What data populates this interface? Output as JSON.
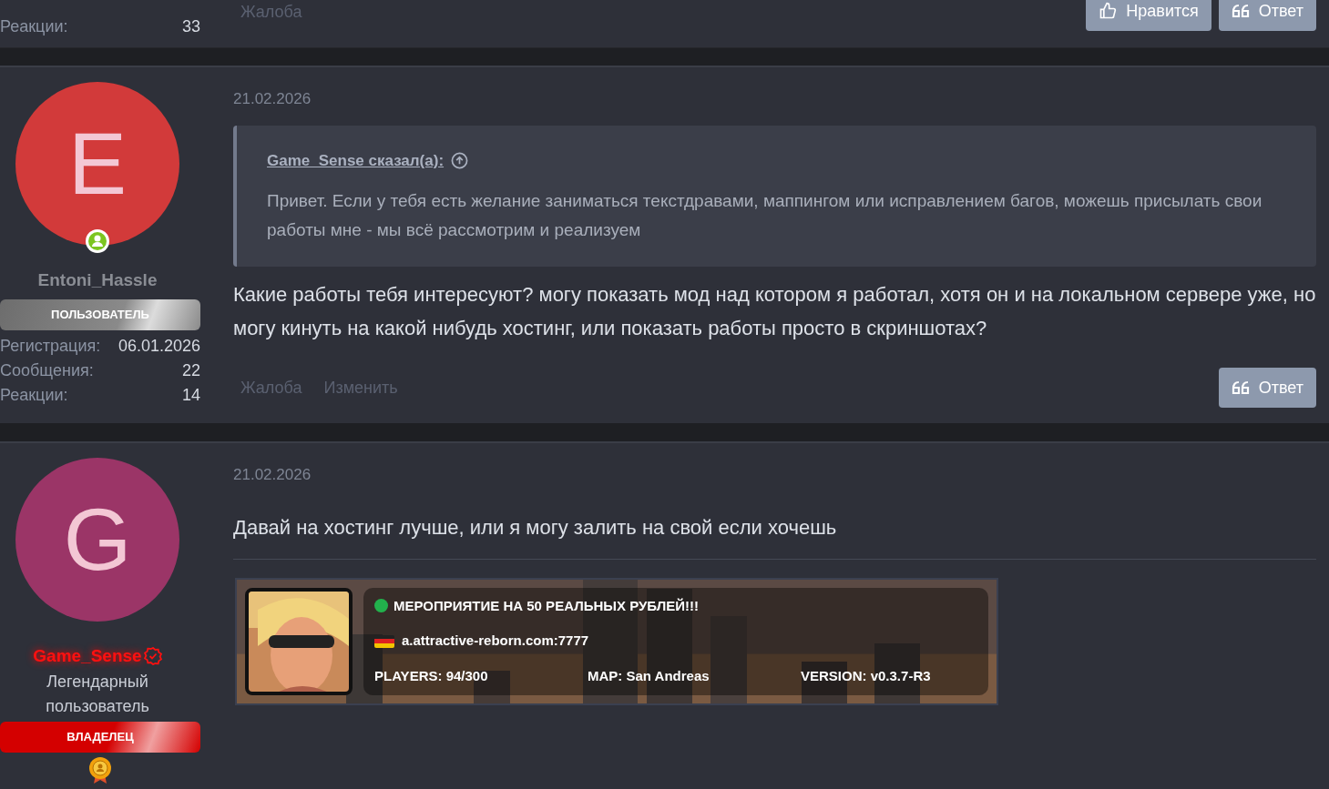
{
  "posts": [
    {
      "kind": "partial",
      "stats": [
        {
          "label": "Реакции:",
          "value": "33"
        }
      ],
      "actions": [
        "Жалоба"
      ],
      "buttons": [
        {
          "kind": "like",
          "label": "Нравится"
        },
        {
          "kind": "reply",
          "label": "Ответ"
        }
      ]
    },
    {
      "kind": "full",
      "avatar_letter": "E",
      "color": "#d23a3a",
      "online": true,
      "username": {
        "kind": "member",
        "text": "Entoni_Hassle"
      },
      "verified": false,
      "badge": {
        "kind": "user",
        "label": "ПОЛЬЗОВАТЕЛЬ"
      },
      "stats": [
        {
          "label": "Регистрация:",
          "value": "06.01.2026"
        },
        {
          "label": "Сообщения:",
          "value": "22"
        },
        {
          "label": "Реакции:",
          "value": "14"
        }
      ],
      "date": "21.02.2026",
      "quote": {
        "author": "Game_Sense сказал(а):",
        "text": "Привет. Если у тебя есть желание заниматься текстдравами, маппингом или исправлением багов, можешь присылать свои работы мне - мы всё рассмотрим и реализуем"
      },
      "body": "Какие работы тебя интересуют? могу показать мод над котором я работал, хотя он и на локальном сервере уже, но могу кинуть на какой нибудь хостинг, или показать работы просто в скриншотах?",
      "actions": [
        "Жалоба",
        "Изменить"
      ],
      "buttons": [
        {
          "kind": "reply",
          "label": "Ответ"
        }
      ]
    },
    {
      "kind": "full",
      "avatar_letter": "G",
      "color": "#9b3567",
      "online": false,
      "username": {
        "kind": "owner",
        "text": "Game_Sense"
      },
      "verified": true,
      "user_title": "Легендарный пользователь",
      "badge": {
        "kind": "owner",
        "label": "ВЛАДЕЛЕЦ"
      },
      "medal": true,
      "date": "21.02.2026",
      "body": "Давай на хостинг лучше, или я могу залить на свой если хочешь",
      "server_banner": {
        "name": "МЕРОПРИЯТИЕ НА 50 РЕАЛЬНЫХ РУБЛЕЙ!!!",
        "online": true,
        "address": "a.attractive-reborn.com:7777",
        "players": "PLAYERS: 94/300",
        "map": "MAP: San Andreas",
        "version": "VERSION: v0.3.7-R3"
      }
    }
  ]
}
